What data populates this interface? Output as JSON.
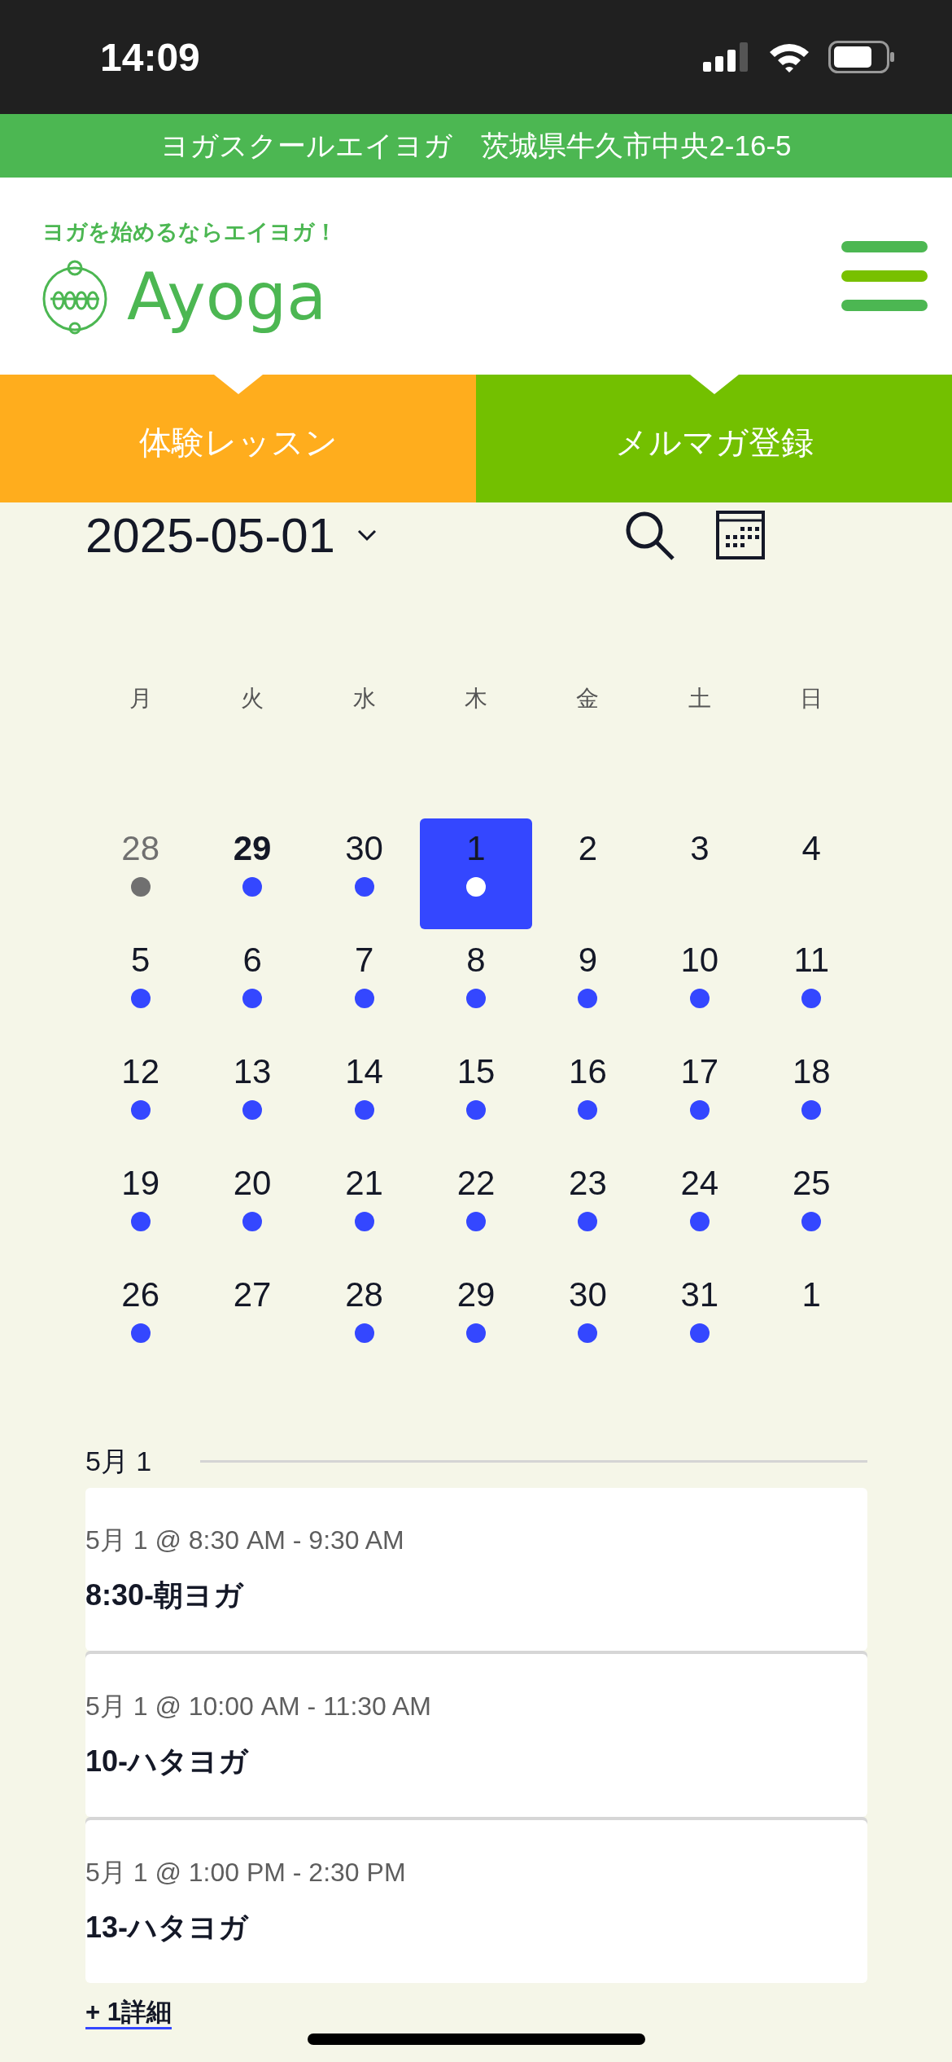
{
  "status_bar": {
    "time": "14:09"
  },
  "top_banner": {
    "text": "ヨガスクールエイヨガ　茨城県牛久市中央2-16-5"
  },
  "header": {
    "tagline": "ヨガを始めるならエイヨガ！",
    "logo_text": "Ayoga"
  },
  "cta_buttons": [
    {
      "label": "体験レッスン",
      "color": "#ffad1d"
    },
    {
      "label": "メルマガ登録",
      "color": "#73c000"
    }
  ],
  "calendar": {
    "date": "2025-05-01",
    "weekdays": [
      "月",
      "火",
      "水",
      "木",
      "金",
      "土",
      "日"
    ],
    "days": [
      {
        "day": "28",
        "muted": true,
        "today": false,
        "selected": false,
        "has_events": true
      },
      {
        "day": "29",
        "muted": false,
        "today": true,
        "selected": false,
        "has_events": true
      },
      {
        "day": "30",
        "muted": false,
        "today": false,
        "selected": false,
        "has_events": true
      },
      {
        "day": "1",
        "muted": false,
        "today": false,
        "selected": true,
        "has_events": true
      },
      {
        "day": "2",
        "muted": false,
        "today": false,
        "selected": false,
        "has_events": false
      },
      {
        "day": "3",
        "muted": false,
        "today": false,
        "selected": false,
        "has_events": false
      },
      {
        "day": "4",
        "muted": false,
        "today": false,
        "selected": false,
        "has_events": false
      },
      {
        "day": "5",
        "muted": false,
        "today": false,
        "selected": false,
        "has_events": true
      },
      {
        "day": "6",
        "muted": false,
        "today": false,
        "selected": false,
        "has_events": true
      },
      {
        "day": "7",
        "muted": false,
        "today": false,
        "selected": false,
        "has_events": true
      },
      {
        "day": "8",
        "muted": false,
        "today": false,
        "selected": false,
        "has_events": true
      },
      {
        "day": "9",
        "muted": false,
        "today": false,
        "selected": false,
        "has_events": true
      },
      {
        "day": "10",
        "muted": false,
        "today": false,
        "selected": false,
        "has_events": true
      },
      {
        "day": "11",
        "muted": false,
        "today": false,
        "selected": false,
        "has_events": true
      },
      {
        "day": "12",
        "muted": false,
        "today": false,
        "selected": false,
        "has_events": true
      },
      {
        "day": "13",
        "muted": false,
        "today": false,
        "selected": false,
        "has_events": true
      },
      {
        "day": "14",
        "muted": false,
        "today": false,
        "selected": false,
        "has_events": true
      },
      {
        "day": "15",
        "muted": false,
        "today": false,
        "selected": false,
        "has_events": true
      },
      {
        "day": "16",
        "muted": false,
        "today": false,
        "selected": false,
        "has_events": true
      },
      {
        "day": "17",
        "muted": false,
        "today": false,
        "selected": false,
        "has_events": true
      },
      {
        "day": "18",
        "muted": false,
        "today": false,
        "selected": false,
        "has_events": true
      },
      {
        "day": "19",
        "muted": false,
        "today": false,
        "selected": false,
        "has_events": true
      },
      {
        "day": "20",
        "muted": false,
        "today": false,
        "selected": false,
        "has_events": true
      },
      {
        "day": "21",
        "muted": false,
        "today": false,
        "selected": false,
        "has_events": true
      },
      {
        "day": "22",
        "muted": false,
        "today": false,
        "selected": false,
        "has_events": true
      },
      {
        "day": "23",
        "muted": false,
        "today": false,
        "selected": false,
        "has_events": true
      },
      {
        "day": "24",
        "muted": false,
        "today": false,
        "selected": false,
        "has_events": true
      },
      {
        "day": "25",
        "muted": false,
        "today": false,
        "selected": false,
        "has_events": true
      },
      {
        "day": "26",
        "muted": false,
        "today": false,
        "selected": false,
        "has_events": true
      },
      {
        "day": "27",
        "muted": false,
        "today": false,
        "selected": false,
        "has_events": false
      },
      {
        "day": "28",
        "muted": false,
        "today": false,
        "selected": false,
        "has_events": true
      },
      {
        "day": "29",
        "muted": false,
        "today": false,
        "selected": false,
        "has_events": true
      },
      {
        "day": "30",
        "muted": false,
        "today": false,
        "selected": false,
        "has_events": true
      },
      {
        "day": "31",
        "muted": false,
        "today": false,
        "selected": false,
        "has_events": true
      },
      {
        "day": "1",
        "muted": false,
        "today": false,
        "selected": false,
        "has_events": false
      }
    ]
  },
  "events": {
    "heading": "5月 1",
    "items": [
      {
        "time": "5月 1 @ 8:30 AM - 9:30 AM",
        "title": "8:30-朝ヨガ"
      },
      {
        "time": "5月 1 @ 10:00 AM - 11:30 AM",
        "title": "10-ハタヨガ"
      },
      {
        "time": "5月 1 @ 1:00 PM - 2:30 PM",
        "title": "13-ハタヨガ"
      }
    ],
    "more_link": "+ 1詳細"
  }
}
